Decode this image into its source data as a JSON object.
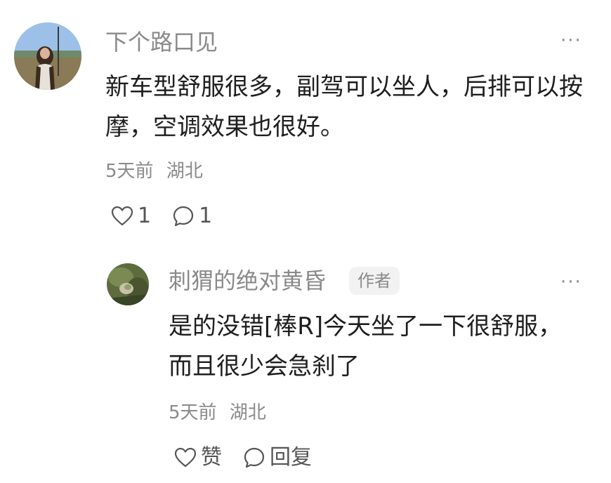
{
  "comment": {
    "username": "下个路口见",
    "more_label": "···",
    "text": "新车型舒服很多，副驾可以坐人，后排可以按摩，空调效果也很好。",
    "time": "5天前",
    "location": "湖北",
    "like_count": "1",
    "reply_count": "1",
    "avatar_icon": "user-avatar-photo",
    "more_icon": "more-dots-icon",
    "like_icon": "heart-outline-icon",
    "reply_icon": "speech-bubble-icon"
  },
  "reply": {
    "username": "刺猬的绝对黄昏",
    "badge": "作者",
    "more_label": "···",
    "text": "是的没错[棒R]今天坐了一下很舒服，而且很少会急刹了",
    "time": "5天前",
    "location": "湖北",
    "like_label": "赞",
    "reply_label": "回复",
    "avatar_icon": "user-avatar-photo",
    "more_icon": "more-dots-icon",
    "like_icon": "heart-outline-icon",
    "reply_icon": "speech-bubble-icon"
  },
  "colors": {
    "background": "#ffffff",
    "username": "#8a8a8a",
    "text": "#1e1e1e",
    "meta": "#8a8a8a",
    "badge_bg": "#f2f2f2"
  }
}
